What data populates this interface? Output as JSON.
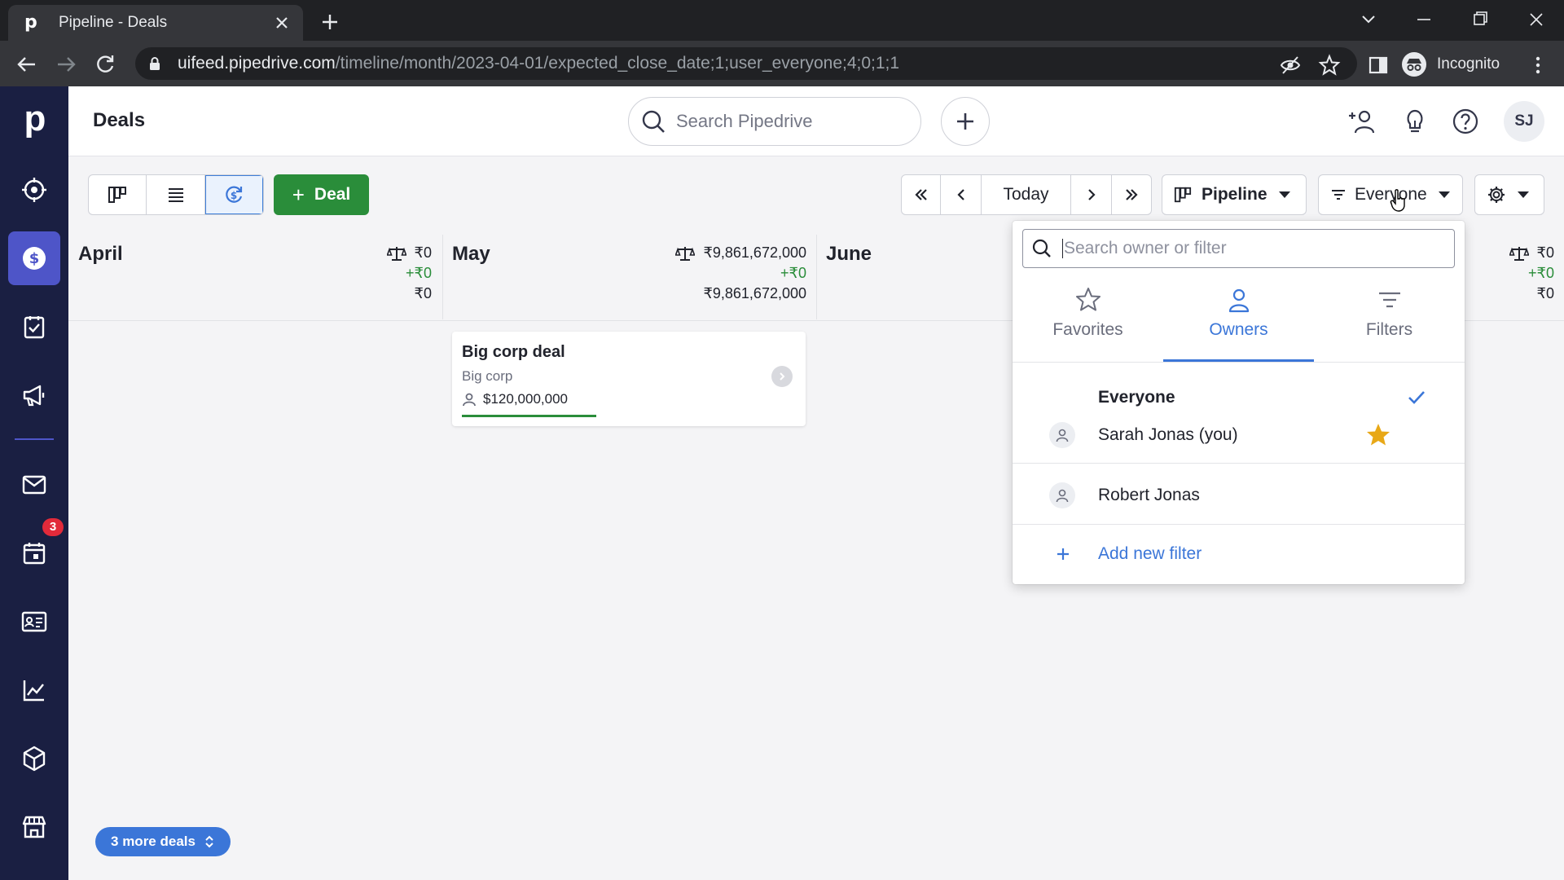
{
  "browser": {
    "tab_title": "Pipeline - Deals",
    "favicon_letter": "p",
    "url_host": "uifeed.pipedrive.com",
    "url_path": "/timeline/month/2023-04-01/expected_close_date;1;user_everyone;4;0;1;1",
    "incognito_label": "Incognito"
  },
  "sidebar": {
    "logo": "p",
    "items": [
      {
        "name": "leads-icon"
      },
      {
        "name": "deals-icon",
        "active": true
      },
      {
        "name": "activities-icon"
      },
      {
        "name": "campaigns-icon"
      },
      {
        "name": "mail-icon"
      },
      {
        "name": "calendar-icon",
        "badge": "3"
      },
      {
        "name": "contacts-icon"
      },
      {
        "name": "insights-icon"
      },
      {
        "name": "products-icon"
      },
      {
        "name": "marketplace-icon"
      }
    ]
  },
  "header": {
    "title": "Deals",
    "search_placeholder": "Search Pipedrive",
    "avatar_initials": "SJ"
  },
  "toolbar": {
    "deal_button": "Deal",
    "today": "Today",
    "pipeline": "Pipeline",
    "owner_filter": "Everyone"
  },
  "timeline": {
    "months": [
      {
        "name": "April",
        "weighted": "₹0",
        "added": "+₹0",
        "total": "₹0"
      },
      {
        "name": "May",
        "weighted": "₹9,861,672,000",
        "added": "+₹0",
        "total": "₹9,861,672,000"
      },
      {
        "name": "June"
      }
    ],
    "right_column": {
      "weighted": "₹0",
      "added": "+₹0",
      "total": "₹0"
    },
    "card": {
      "title": "Big corp deal",
      "org": "Big corp",
      "value": "$120,000,000"
    },
    "more_deals": "3 more deals"
  },
  "dropdown": {
    "search_placeholder": "Search owner or filter",
    "tabs": [
      {
        "label": "Favorites"
      },
      {
        "label": "Owners",
        "active": true
      },
      {
        "label": "Filters"
      }
    ],
    "everyone": "Everyone",
    "owners": [
      {
        "name": "Sarah Jonas (you)",
        "favorite": true
      },
      {
        "name": "Robert Jonas",
        "favorite": false
      }
    ],
    "add_filter": "Add new filter"
  },
  "colors": {
    "sidebar_bg": "#1a1f42",
    "sidebar_active": "#4e55c8",
    "primary_green": "#2a8d3a",
    "link_blue": "#3b76d8",
    "star": "#e8a817",
    "badge": "#e22a3a"
  }
}
